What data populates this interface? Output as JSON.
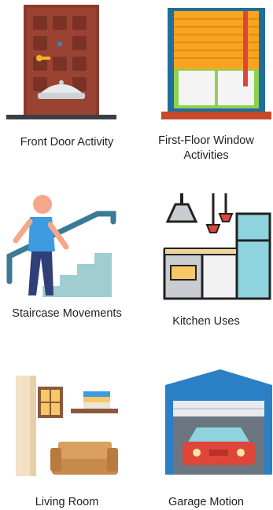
{
  "tiles": [
    {
      "label": "Front Door Activity",
      "icon": "front-door-icon"
    },
    {
      "label": "First-Floor Window Activities",
      "icon": "window-icon"
    },
    {
      "label": "Staircase Movements",
      "icon": "staircase-icon"
    },
    {
      "label": "Kitchen Uses",
      "icon": "kitchen-icon"
    },
    {
      "label": "Living Room",
      "icon": "living-room-icon"
    },
    {
      "label": "Garage Motion",
      "icon": "garage-icon"
    }
  ],
  "colors": {
    "door": "#8b3a2b",
    "door_panel": "#7a3226",
    "window_blind": "#f7a520",
    "window_frame": "#1f6e9c",
    "sill": "#c64a29",
    "person_shirt": "#3d9be0",
    "stairs": "#9fcdd1",
    "railing": "#3a7a96",
    "fridge": "#8fd3de",
    "garage_blue": "#2b7fc4",
    "car": "#e0453a"
  }
}
